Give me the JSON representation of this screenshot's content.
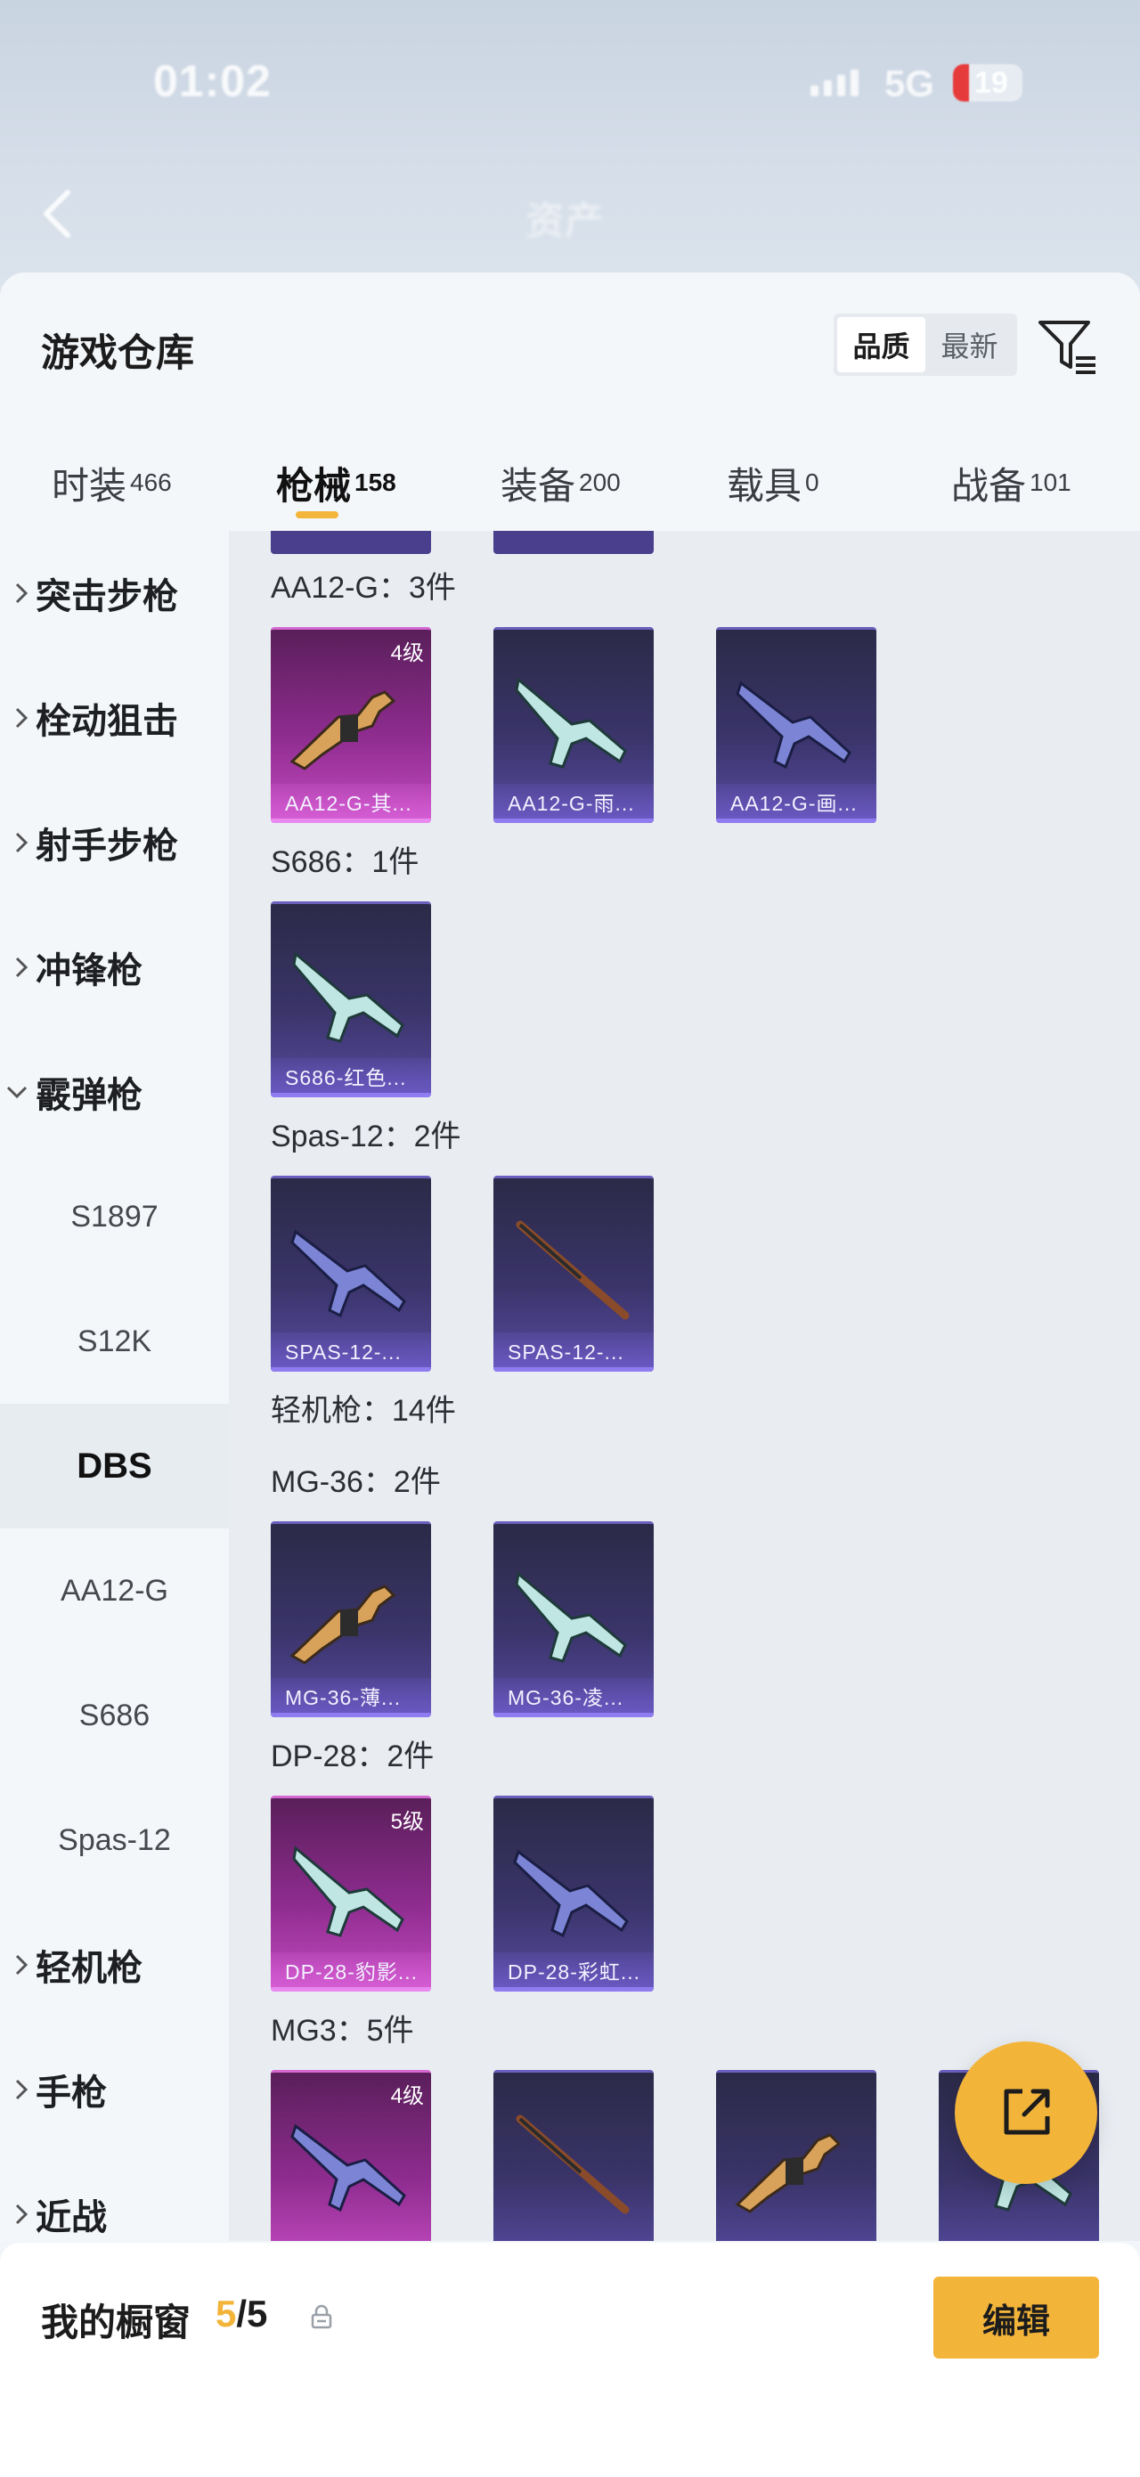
{
  "status": {
    "time": "01:02",
    "network": "5G",
    "battery": "19",
    "blurred_title": "资产"
  },
  "sheet": {
    "title": "游戏仓库",
    "sort": {
      "options": [
        "品质",
        "最新"
      ],
      "active": "品质"
    }
  },
  "tabs": [
    {
      "label": "时装",
      "count": "466"
    },
    {
      "label": "枪械",
      "count": "158"
    },
    {
      "label": "装备",
      "count": "200"
    },
    {
      "label": "载具",
      "count": "0"
    },
    {
      "label": "战备",
      "count": "101"
    }
  ],
  "active_tab": "枪械",
  "sidemenu": {
    "categories": [
      {
        "label": "突击步枪",
        "expanded": false
      },
      {
        "label": "栓动狙击",
        "expanded": false
      },
      {
        "label": "射手步枪",
        "expanded": false
      },
      {
        "label": "冲锋枪",
        "expanded": false
      },
      {
        "label": "霰弹枪",
        "expanded": true
      },
      {
        "label": "轻机枪",
        "expanded": false
      },
      {
        "label": "手枪",
        "expanded": false
      },
      {
        "label": "近战",
        "expanded": false
      }
    ],
    "shotgun_subs": [
      "S1897",
      "S12K",
      "DBS",
      "AA12-G",
      "S686",
      "Spas-12"
    ],
    "active_sub": "DBS"
  },
  "groups": [
    {
      "title": "AA12-G：3件",
      "cards": [
        {
          "caption": "AA12-G-其...",
          "level": "4级",
          "tier": "pink"
        },
        {
          "caption": "AA12-G-雨...",
          "level": "",
          "tier": "blue"
        },
        {
          "caption": "AA12-G-画...",
          "level": "",
          "tier": "blue"
        }
      ]
    },
    {
      "title": "S686：1件",
      "cards": [
        {
          "caption": "S686-红色...",
          "level": "",
          "tier": "blue"
        }
      ]
    },
    {
      "title": "Spas-12：2件",
      "cards": [
        {
          "caption": "SPAS-12-...",
          "level": "",
          "tier": "blue"
        },
        {
          "caption": "SPAS-12-...",
          "level": "",
          "tier": "blue"
        }
      ]
    },
    {
      "title": "轻机枪：14件",
      "cards": []
    },
    {
      "title": "MG-36：2件",
      "cards": [
        {
          "caption": "MG-36-薄...",
          "level": "",
          "tier": "blue"
        },
        {
          "caption": "MG-36-凌...",
          "level": "",
          "tier": "blue"
        }
      ]
    },
    {
      "title": "DP-28：2件",
      "cards": [
        {
          "caption": "DP-28-豹影...",
          "level": "5级",
          "tier": "pink"
        },
        {
          "caption": "DP-28-彩虹...",
          "level": "",
          "tier": "blue"
        }
      ]
    },
    {
      "title": "MG3：5件",
      "cards": [
        {
          "caption": "",
          "level": "4级",
          "tier": "pink"
        },
        {
          "caption": "",
          "level": "",
          "tier": "blue"
        },
        {
          "caption": "",
          "level": "",
          "tier": "blue"
        },
        {
          "caption": "",
          "level": "",
          "tier": "blue"
        }
      ]
    }
  ],
  "bottom": {
    "window_label": "我的橱窗",
    "used": "5",
    "total": "/5",
    "edit_label": "编辑"
  },
  "colors": {
    "accent": "#f3b43a",
    "tier_blue": "#574aa1",
    "tier_pink": "#c54bc1"
  },
  "icons": [
    "back-arrow-icon",
    "filter-icon",
    "chevron-right-icon",
    "chevron-down-icon",
    "lock-icon",
    "share-out-icon"
  ]
}
